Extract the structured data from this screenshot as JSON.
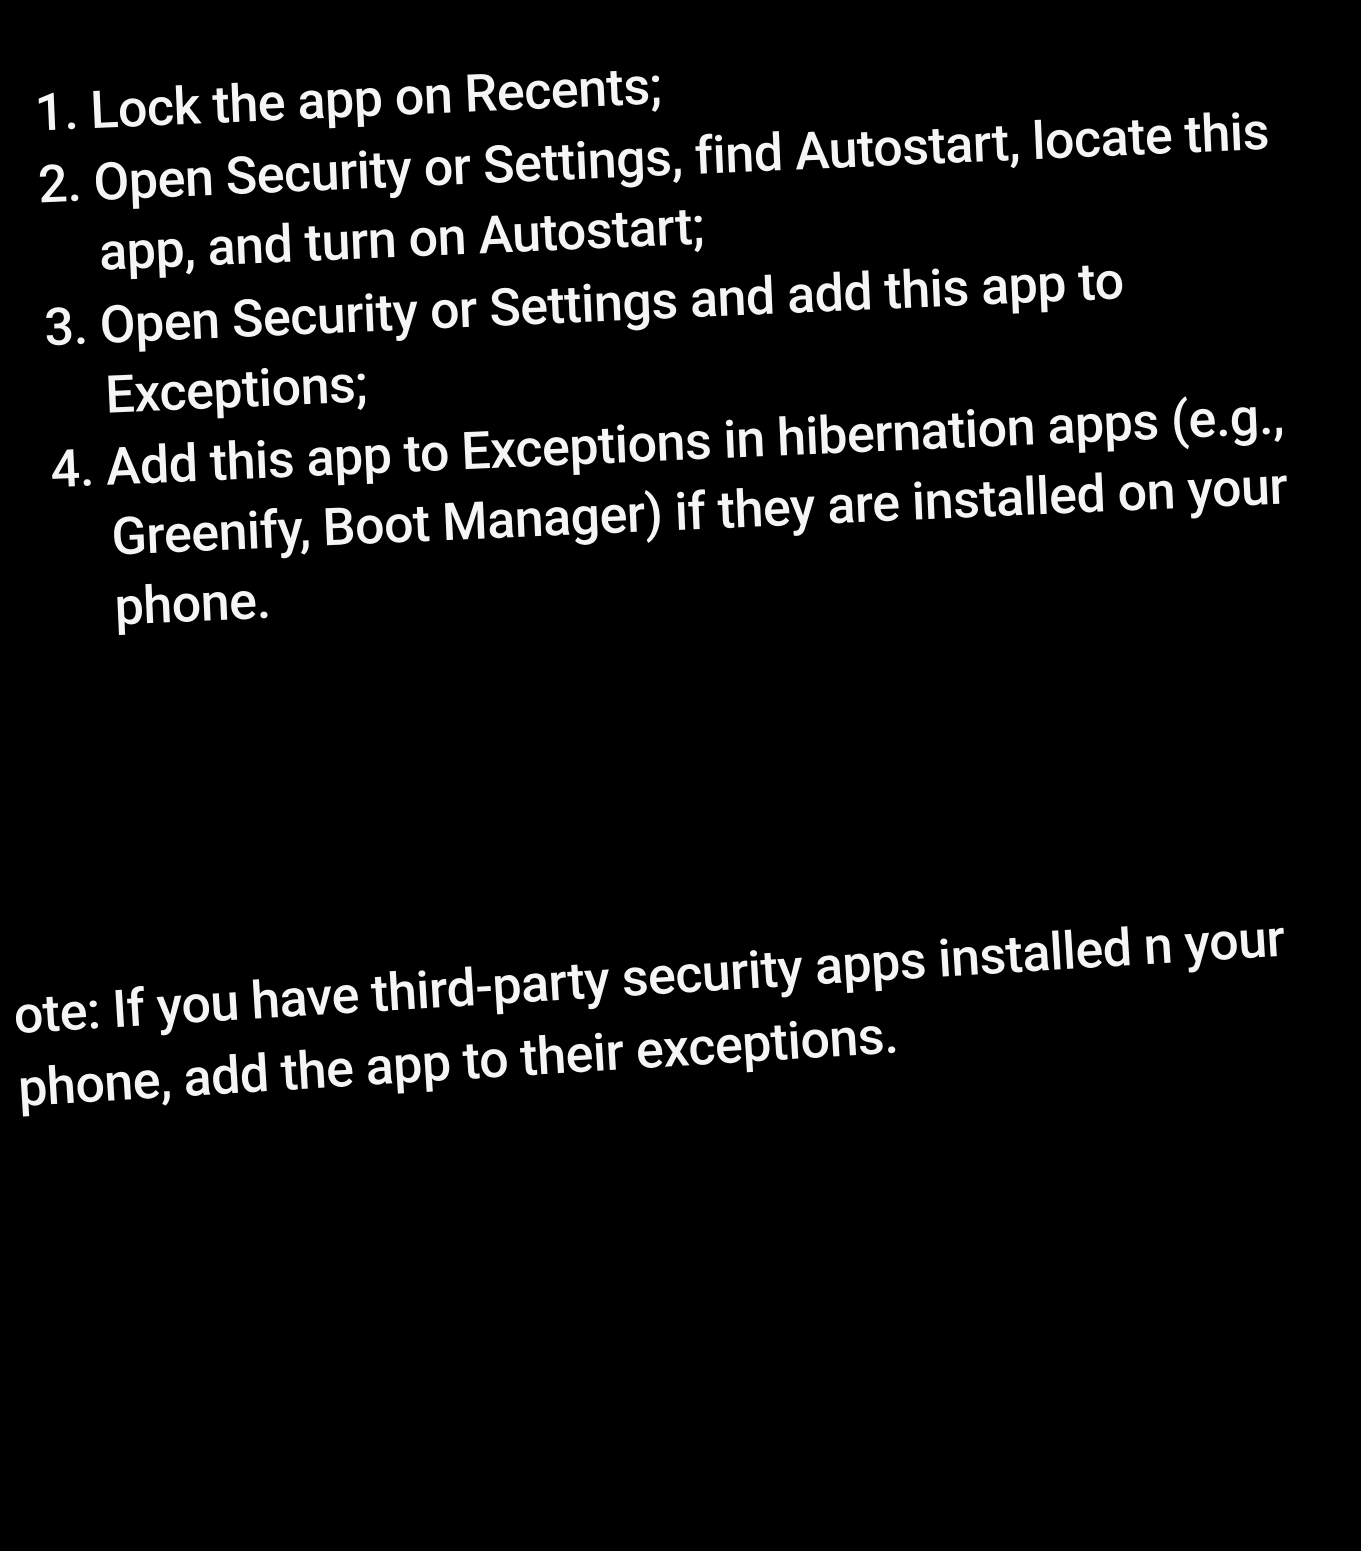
{
  "instructions": {
    "steps": [
      "Lock the app on Recents;",
      "Open Security or Settings, find Autostart, locate this app, and turn on Autostart;",
      "Open Security or Settings and add this app to Exceptions;",
      "Add this app to Exceptions in hibernation apps (e.g., Greenify, Boot Manager) if they are installed on your phone."
    ],
    "note": "ote: If you have third-party security apps installed n your phone, add the app to their exceptions."
  }
}
